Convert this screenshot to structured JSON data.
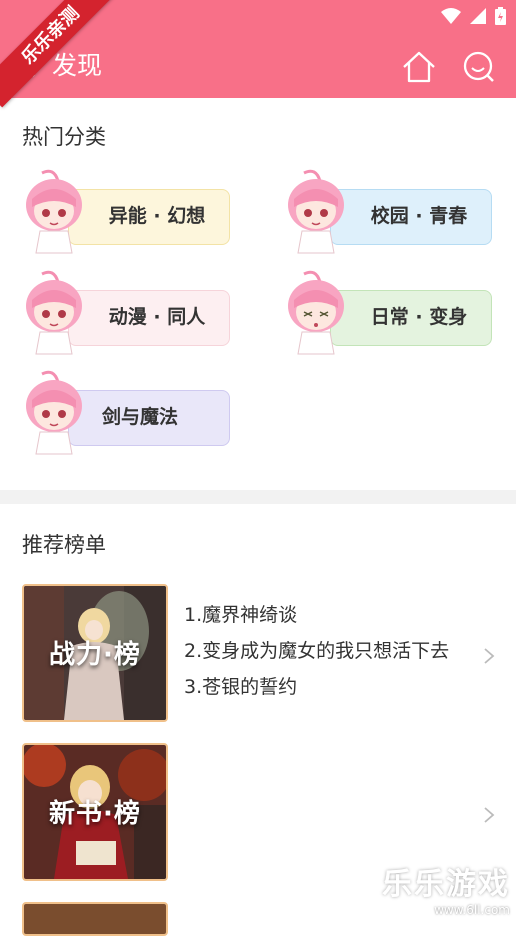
{
  "watermark_corner": "乐乐亲测",
  "header": {
    "title": "发现"
  },
  "hot": {
    "title": "热门分类",
    "categories": [
      {
        "label": "异能 · 幻想",
        "bg": "#fdf6dc",
        "border": "#f3e3a6"
      },
      {
        "label": "校园 · 青春",
        "bg": "#def0fb",
        "border": "#b6dcf3"
      },
      {
        "label": "动漫 · 同人",
        "bg": "#fdeff1",
        "border": "#f6d4da"
      },
      {
        "label": "日常 · 变身",
        "bg": "#e4f3df",
        "border": "#c3e4b8"
      },
      {
        "label": "剑与魔法",
        "bg": "#e9e7f9",
        "border": "#cfcaf0"
      }
    ]
  },
  "rec": {
    "title": "推荐榜单",
    "boards": [
      {
        "label": "战力·榜",
        "items": [
          "1.魔界神绮谈",
          "2.变身成为魔女的我只想活下去",
          "3.苍银的誓约"
        ]
      },
      {
        "label": "新书·榜",
        "items": []
      }
    ]
  },
  "watermark": {
    "line1": "乐乐游戏",
    "line2": "www.6ll.com"
  },
  "colors": {
    "accent": "#f87088"
  }
}
